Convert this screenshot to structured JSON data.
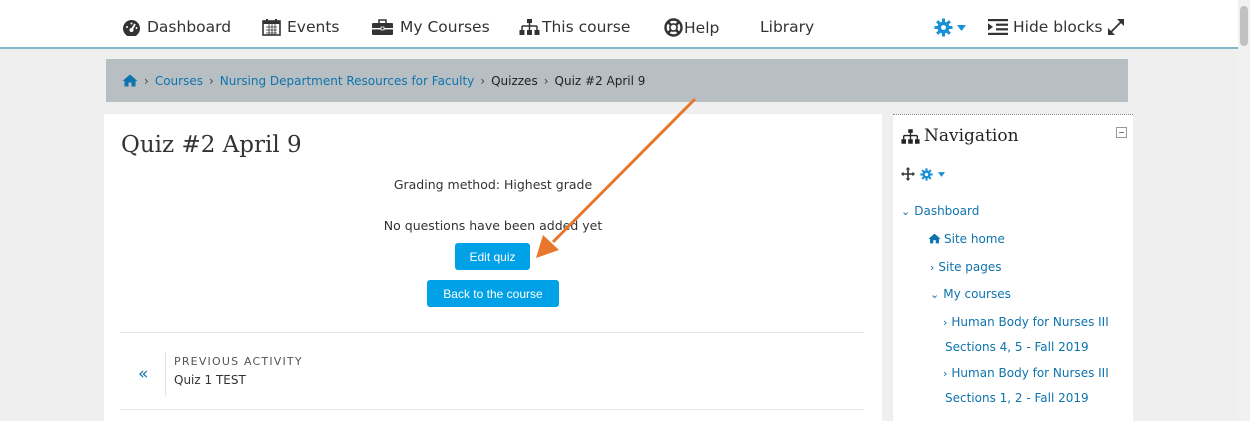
{
  "navbar": {
    "dashboard": "Dashboard",
    "events": "Events",
    "my_courses": "My Courses",
    "this_course": "This course",
    "help": "Help",
    "library": "Library",
    "hide_blocks": "Hide blocks"
  },
  "breadcrumb": {
    "items": [
      "Courses",
      "Nursing Department Resources for Faculty",
      "Quizzes",
      "Quiz #2 April 9"
    ],
    "separator": "›"
  },
  "main": {
    "title": "Quiz #2 April 9",
    "grading_method": "Grading method: Highest grade",
    "no_questions": "No questions have been added yet",
    "edit_quiz": "Edit quiz",
    "back_to_course": "Back to the course",
    "previous_activity_label": "PREVIOUS ACTIVITY",
    "previous_activity_name": "Quiz 1 TEST",
    "prev_arrow": "«"
  },
  "navigation": {
    "title": "Navigation",
    "dashboard": "Dashboard",
    "site_home": "Site home",
    "site_pages": "Site pages",
    "my_courses": "My courses",
    "course1_line1": "Human Body for Nurses III",
    "course1_line2": "Sections 4, 5 - Fall 2019",
    "course2_line1": "Human Body for Nurses III",
    "course2_line2": "Sections 1, 2 - Fall 2019"
  },
  "colors": {
    "accent_button": "#00a1e7",
    "link": "#0f73ad",
    "annotation_arrow": "#e8772e",
    "breadcrumb_bg": "#b8bfc3",
    "nav_border": "#80b9c6"
  }
}
